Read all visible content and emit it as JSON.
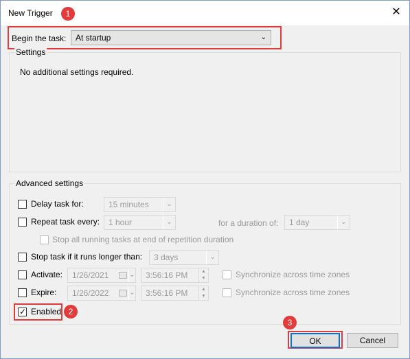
{
  "window": {
    "title": "New Trigger",
    "close_glyph": "✕"
  },
  "badges": [
    "1",
    "2",
    "3"
  ],
  "begin": {
    "label": "Begin the task:",
    "value": "At startup"
  },
  "settings": {
    "title": "Settings",
    "message": "No additional settings required."
  },
  "advanced": {
    "title": "Advanced settings",
    "delay": {
      "label": "Delay task for:",
      "value": "15 minutes",
      "checked": false
    },
    "repeat": {
      "label": "Repeat task every:",
      "value": "1 hour",
      "checked": false,
      "duration_label": "for a duration of:",
      "duration_value": "1 day"
    },
    "stop_running": {
      "label": "Stop all running tasks at end of repetition duration",
      "checked": false
    },
    "stop_longer": {
      "label": "Stop task if it runs longer than:",
      "value": "3 days",
      "checked": false
    },
    "activate": {
      "label": "Activate:",
      "date": "1/26/2021",
      "time": "3:56:16 PM",
      "sync_label": "Synchronize across time zones",
      "checked": false
    },
    "expire": {
      "label": "Expire:",
      "date": "1/26/2022",
      "time": "3:56:16 PM",
      "sync_label": "Synchronize across time zones",
      "checked": false
    },
    "enabled": {
      "label": "Enabled",
      "checked": true
    }
  },
  "buttons": {
    "ok": "OK",
    "cancel": "Cancel"
  },
  "colors": {
    "highlight": "#e23b3b",
    "primary_border": "#0078d7"
  }
}
